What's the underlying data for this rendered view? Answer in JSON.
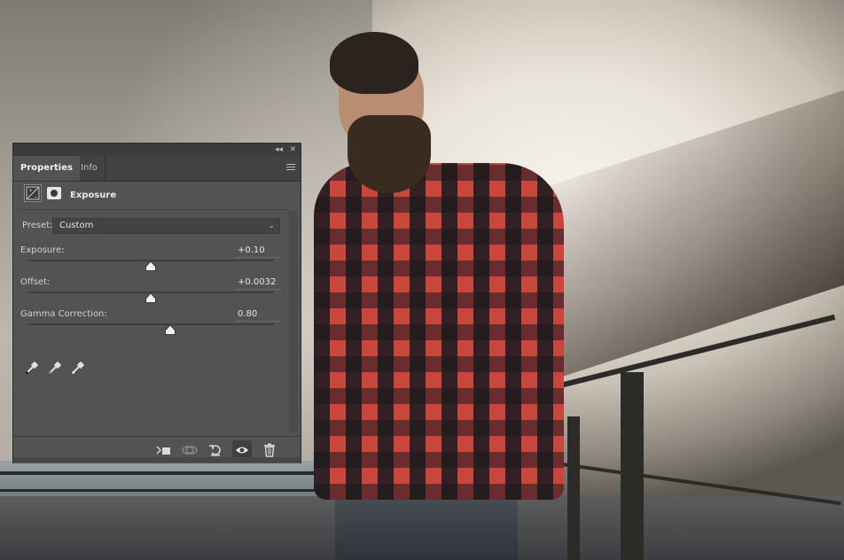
{
  "panel": {
    "tabs": [
      {
        "label": "Properties",
        "active": true
      },
      {
        "label": "Info",
        "active": false
      }
    ],
    "header_controls": {
      "collapse": "◂◂",
      "close": "✕"
    },
    "adjustment": {
      "title": "Exposure",
      "icons": [
        "exposure-adjustment-icon",
        "layer-mask-icon"
      ]
    },
    "preset": {
      "label": "Preset:",
      "value": "Custom"
    },
    "sliders": [
      {
        "label": "Exposure:",
        "value": "+0.10",
        "level": 0.5
      },
      {
        "label": "Offset:",
        "value": "+0.0032",
        "level": 0.5
      },
      {
        "label": "Gamma Correction:",
        "value": "0.80",
        "level": 0.58
      }
    ],
    "eyedroppers": [
      "black-point-eyedropper-icon",
      "gray-point-eyedropper-icon",
      "white-point-eyedropper-icon"
    ],
    "footer_buttons": [
      "clip-to-layer-icon",
      "view-previous-state-icon",
      "reset-icon",
      "toggle-visibility-icon",
      "delete-icon"
    ]
  },
  "colors": {
    "panel_bg": "#535353",
    "tab_bar": "#424242",
    "shirt": "#c8463d"
  }
}
